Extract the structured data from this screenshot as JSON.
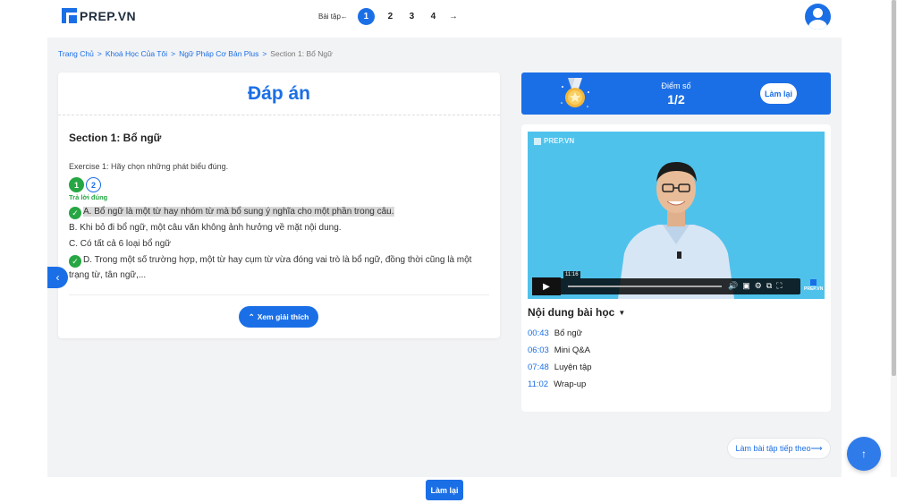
{
  "header": {
    "logo_text": "PREP.VN",
    "pager": {
      "label": "Bài tập",
      "pages": [
        "1",
        "2",
        "3",
        "4"
      ],
      "active": "1"
    }
  },
  "breadcrumb": [
    "Trang Chủ",
    "Khoá Học Của Tôi",
    "Ngữ Pháp Cơ Bản Plus",
    "Section 1: Bổ Ngữ"
  ],
  "answer_card": {
    "title": "Đáp án",
    "section_title": "Section 1: Bổ ngữ",
    "exercise": "Exercise 1: Hãy chọn những phát biểu đúng.",
    "question_badges": [
      "1",
      "2"
    ],
    "correct_label": "Trả lời đúng",
    "options": [
      {
        "text": "A. Bổ ngữ là một từ hay nhóm từ mà bổ sung ý nghĩa cho một phần trong câu.",
        "checked": true
      },
      {
        "text": "B. Khi bỏ đi bổ ngữ, một câu văn không ảnh hưởng về mặt nội dung.",
        "checked": false
      },
      {
        "text": "C. Có tất cả 6 loại bổ ngữ",
        "checked": false
      },
      {
        "text": "D. Trong một số trường hợp, một từ hay cụm từ vừa đóng vai trò là bổ ngữ, đồng thời cũng là một trạng từ, tân ngữ,...",
        "checked": true
      }
    ],
    "explain_button": "Xem giải thích"
  },
  "score": {
    "label": "Điểm số",
    "value": "1/2",
    "retry_label": "Làm lại"
  },
  "video": {
    "logo_text": "PREP.VN",
    "time_tooltip": "11:16",
    "brand": "PREP.VN",
    "progress": 0.02
  },
  "contents": {
    "title": "Nội dung bài học",
    "items": [
      {
        "time": "00:43",
        "name": "Bổ ngữ"
      },
      {
        "time": "06:03",
        "name": "Mini Q&A"
      },
      {
        "time": "07:48",
        "name": "Luyện tập"
      },
      {
        "time": "11:02",
        "name": "Wrap-up"
      }
    ]
  },
  "next_exercise": "Làm bài tập tiếp theo",
  "footer": {
    "retry_label": "Làm lại"
  },
  "colors": {
    "primary": "#1b6fe6",
    "success": "#27a644",
    "video_bg": "#4fc2ec"
  }
}
